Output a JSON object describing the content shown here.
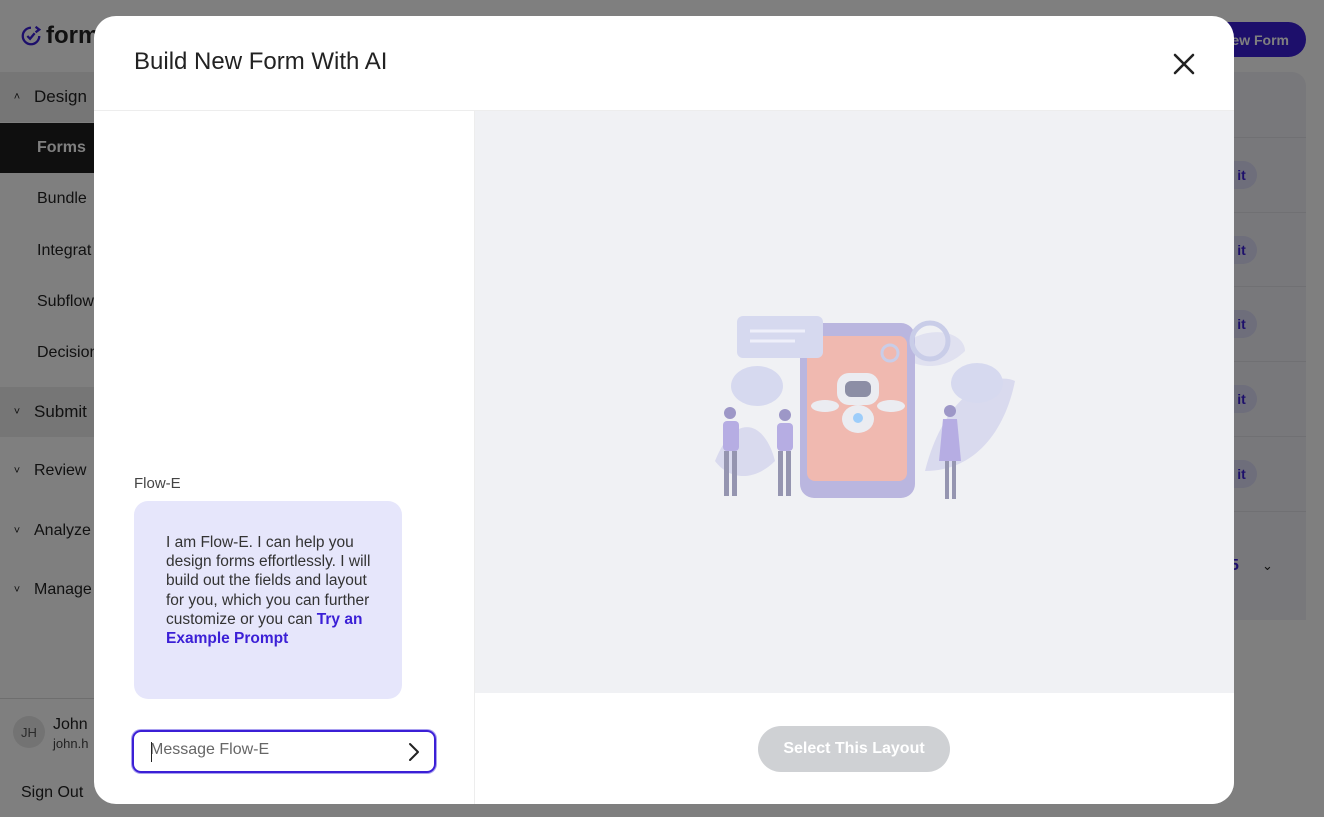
{
  "app": {
    "logo_text": "forms",
    "nav": {
      "design_label": "Design",
      "items": [
        "Forms",
        "Bundle",
        "Integrat",
        "Subflow",
        "Decision"
      ],
      "submit_label": "Submit",
      "review_label": "Review",
      "analyze_label": "Analyze",
      "manage_label": "Manage"
    },
    "user": {
      "initials": "JH",
      "name": "John",
      "email": "john.h"
    },
    "sign_out_label": "Sign Out",
    "new_form_button": "ew Form",
    "edit_fragments": [
      "it",
      "it",
      "it",
      "it",
      "it"
    ],
    "page_number": "5"
  },
  "modal": {
    "title": "Build New Form With AI",
    "assistant_name": "Flow-E",
    "intro_text": "I am Flow-E. I can help you design forms effortlessly. I will build out the fields and layout for you, which you can further customize or you can",
    "example_link": "Try an Example Prompt",
    "message_placeholder": "Message Flow-E",
    "message_value": "",
    "select_layout_button": "Select This Layout",
    "select_layout_disabled": true
  },
  "colors": {
    "accent": "#3b1fd6",
    "bubble_bg": "#e6e6fb",
    "preview_bg": "#f0f1f4",
    "disabled_button": "#cfd1d4"
  },
  "icons": {
    "close": "close-icon",
    "send": "chevron-right-icon",
    "logo": "refresh-check-logo"
  }
}
